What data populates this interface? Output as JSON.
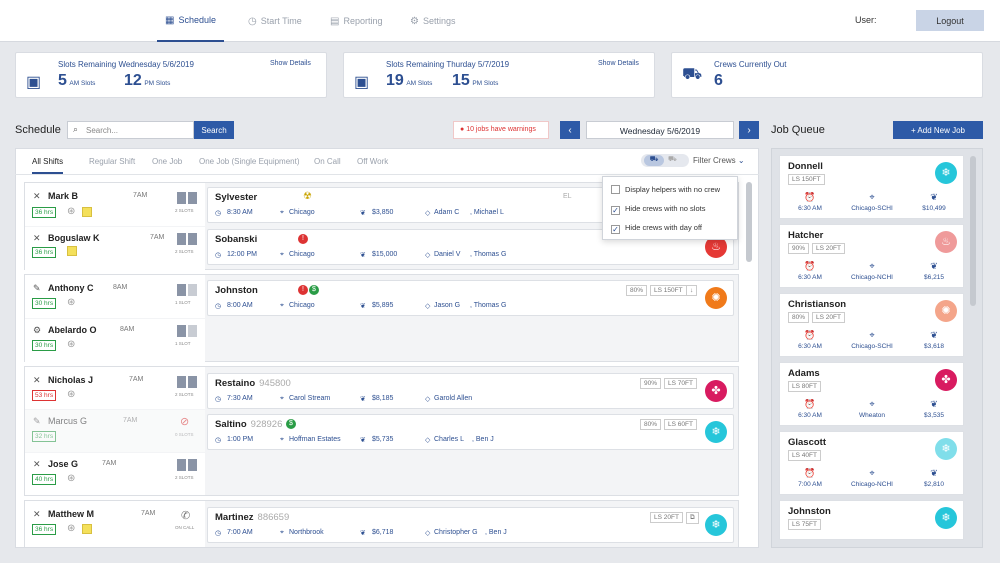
{
  "nav": {
    "items": [
      "Schedule",
      "Start Time",
      "Reporting",
      "Settings"
    ],
    "user_label": "User:",
    "logout": "Logout"
  },
  "summary": [
    {
      "title": "Slots Remaining Wednesday 5/6/2019",
      "show": "Show Details",
      "am": "5",
      "am_lbl": "AM Slots",
      "pm": "12",
      "pm_lbl": "PM Slots"
    },
    {
      "title": "Slots Remaining Thurday 5/7/2019",
      "show": "Show Details",
      "am": "19",
      "am_lbl": "AM Slots",
      "pm": "15",
      "pm_lbl": "PM Slots"
    },
    {
      "title": "Crews Currently Out",
      "value": "6"
    }
  ],
  "schedule": {
    "title": "Schedule",
    "search_placeholder": "Search...",
    "search_btn": "Search",
    "warning": "10 jobs have warnings",
    "date": "Wednesday 5/6/2019",
    "tabs": [
      "All Shifts",
      "Regular Shift",
      "One Job",
      "One Job (Single Equipment)",
      "On Call",
      "Off Work"
    ],
    "filter": "Filter Crews",
    "filter_opts": [
      "Display helpers with no crew",
      "Hide crews with no slots",
      "Hide crews with day off"
    ],
    "slots_lbl": "2 SLOTS",
    "slot1_lbl": "1 SLOT",
    "zero_lbl": "0 SLOTS",
    "oncall": "ON CALL"
  },
  "crews": [
    {
      "name": "Mark B",
      "time": "7AM",
      "hrs": "36 hrs"
    },
    {
      "name": "Boguslaw K",
      "time": "7AM",
      "hrs": "36 hrs"
    },
    {
      "name": "Anthony C",
      "time": "8AM",
      "hrs": "30 hrs"
    },
    {
      "name": "Abelardo O",
      "time": "8AM",
      "hrs": "30 hrs"
    },
    {
      "name": "Nicholas J",
      "time": "7AM",
      "hrs": "53 hrs"
    },
    {
      "name": "Marcus G",
      "time": "7AM",
      "hrs": "32 hrs"
    },
    {
      "name": "Jose G",
      "time": "7AM",
      "hrs": "40 hrs"
    },
    {
      "name": "Matthew M",
      "time": "7AM",
      "hrs": "36 hrs"
    }
  ],
  "jobs": [
    {
      "name": "Sylvester",
      "id": "",
      "time": "8:30 AM",
      "city": "Chicago",
      "price": "$3,850",
      "crew": "Adam C",
      "crew2": ", Michael L",
      "tag": "EL"
    },
    {
      "name": "Sobanski",
      "id": "",
      "time": "12:00 PM",
      "city": "Chicago",
      "price": "$15,000",
      "crew": "Daniel V",
      "crew2": ", Thomas G"
    },
    {
      "name": "Johnston",
      "id": "",
      "time": "8:00 AM",
      "city": "Chicago",
      "price": "$5,895",
      "crew": "Jason G",
      "crew2": ", Thomas G",
      "pct": "80%",
      "ls": "LS 150FT",
      "extra": "↓"
    },
    {
      "name": "Restaino",
      "id": "945800",
      "time": "7:30 AM",
      "city": "Carol Stream",
      "price": "$8,185",
      "crew": "Garold Allen",
      "crew2": "",
      "pct": "90%",
      "ls": "LS 70FT"
    },
    {
      "name": "Saltino",
      "id": "928926",
      "time": "1:00 PM",
      "city": "Hoffman Estates",
      "price": "$5,735",
      "crew": "Charles L",
      "crew2": ", Ben J",
      "pct": "80%",
      "ls": "LS 60FT"
    },
    {
      "name": "Martinez",
      "id": "886659",
      "time": "7:00 AM",
      "city": "Northbrook",
      "price": "$6,718",
      "crew": "Christopher G",
      "crew2": ", Ben J",
      "ls": "LS 20FT"
    }
  ],
  "queue": {
    "title": "Job Queue",
    "add": "+ Add New Job",
    "items": [
      {
        "name": "Donnell",
        "tag": "LS 150FT",
        "time": "6:30 AM",
        "city": "Chicago-SCHI",
        "price": "$10,499"
      },
      {
        "name": "Hatcher",
        "pct": "90%",
        "tag": "LS 20FT",
        "time": "6:30 AM",
        "city": "Chicago-NCHI",
        "price": "$6,215"
      },
      {
        "name": "Christianson",
        "pct": "80%",
        "tag": "LS 20FT",
        "time": "6:30 AM",
        "city": "Chicago-SCHI",
        "price": "$3,618"
      },
      {
        "name": "Adams",
        "tag": "LS 80FT",
        "time": "6:30 AM",
        "city": "Wheaton",
        "price": "$3,535"
      },
      {
        "name": "Glascott",
        "tag": "LS 40FT",
        "time": "7:00 AM",
        "city": "Chicago-NCHI",
        "price": "$2,810"
      },
      {
        "name": "Johnston",
        "tag": "LS 75FT"
      }
    ]
  }
}
